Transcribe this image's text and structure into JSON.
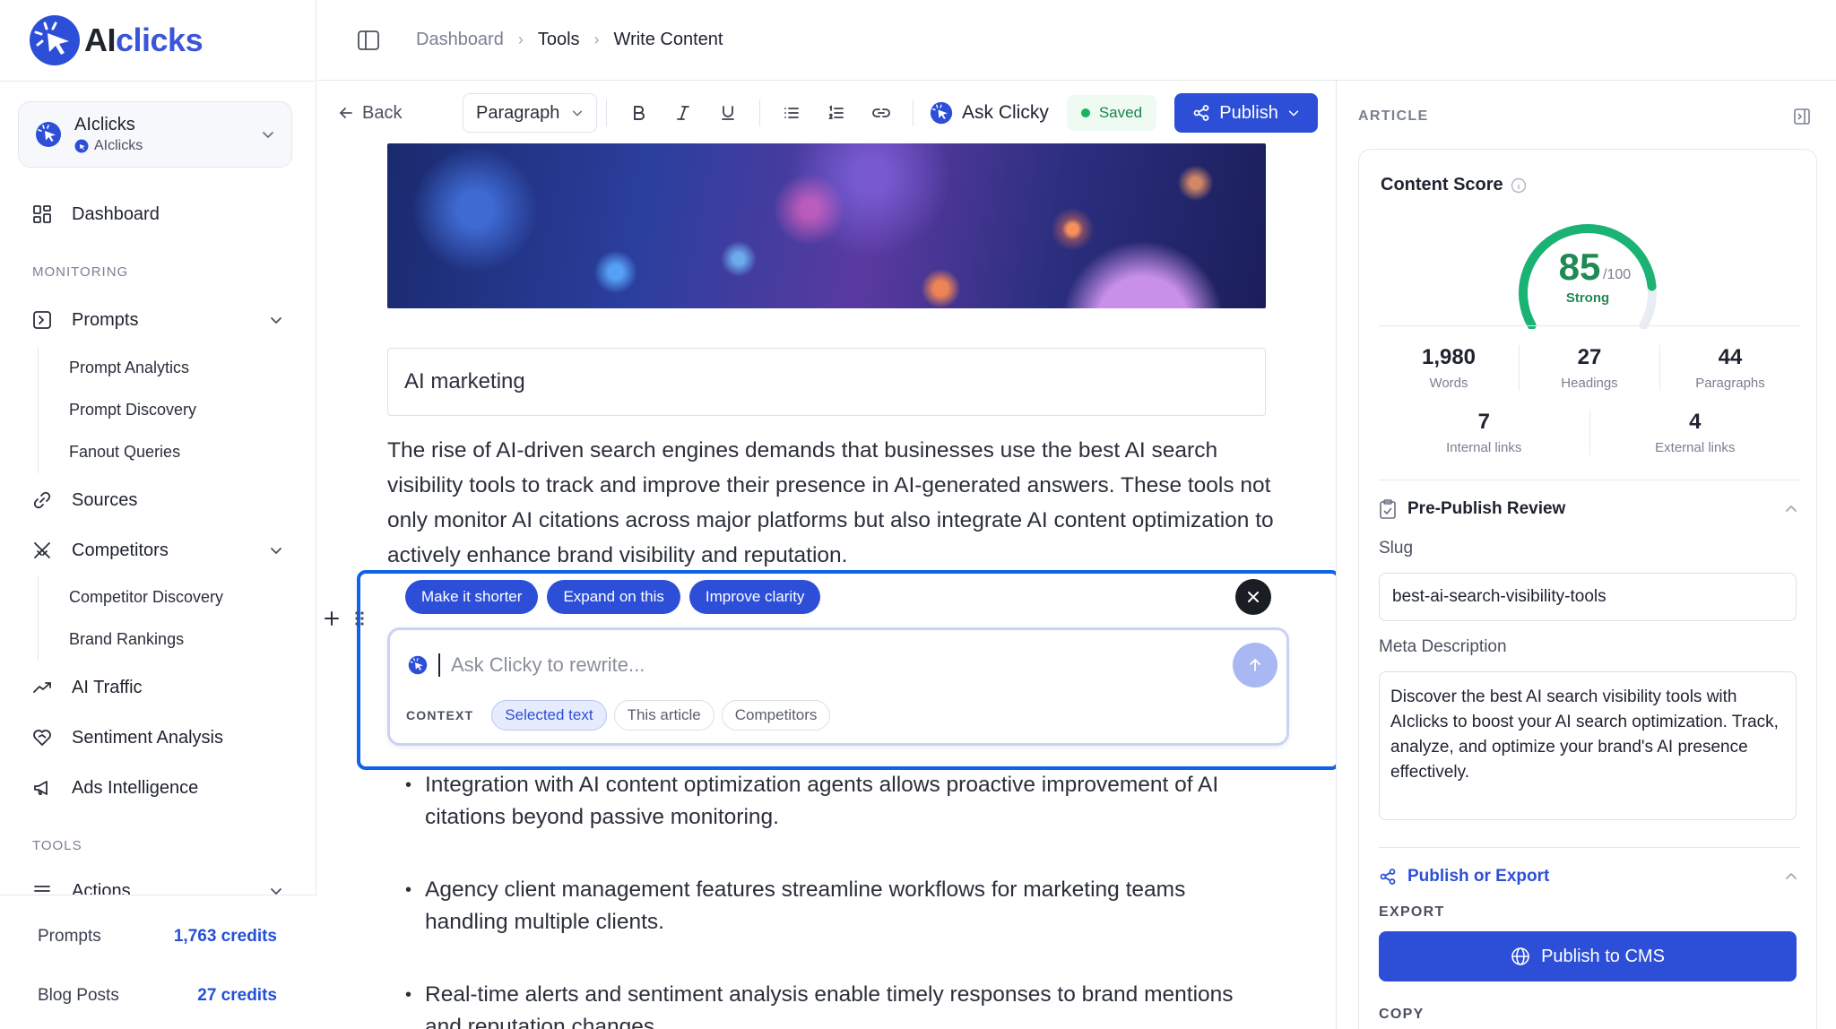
{
  "app": {
    "brand_a": "AI",
    "brand_b": "clicks",
    "accent": "#2d4fd8"
  },
  "workspace": {
    "title": "AIclicks",
    "subtitle": "AIclicks"
  },
  "sidebar": {
    "dashboard": "Dashboard",
    "monitoring_label": "MONITORING",
    "prompts": "Prompts",
    "prompts_sub": [
      "Prompt Analytics",
      "Prompt Discovery",
      "Fanout Queries"
    ],
    "sources": "Sources",
    "competitors": "Competitors",
    "competitors_sub": [
      "Competitor Discovery",
      "Brand Rankings"
    ],
    "ai_traffic": "AI Traffic",
    "sentiment": "Sentiment Analysis",
    "ads": "Ads Intelligence",
    "tools_label": "TOOLS",
    "actions": "Actions"
  },
  "credits": [
    {
      "label": "Prompts",
      "value": "1,763 credits"
    },
    {
      "label": "Blog Posts",
      "value": "27 credits"
    }
  ],
  "breadcrumb": [
    "Dashboard",
    "Tools",
    "Write Content"
  ],
  "toolbar": {
    "back": "Back",
    "block_type": "Paragraph",
    "ask_clicky": "Ask Clicky",
    "saved": "Saved",
    "publish": "Publish"
  },
  "editor": {
    "keyword": "AI marketing",
    "intro": "The rise of AI-driven search engines demands that businesses use the best AI search visibility tools to track and improve their presence in AI-generated answers. These tools not only monitor AI citations across major platforms but also integrate AI content optimization to actively enhance brand visibility and reputation.",
    "bullets": [
      "Integration with AI content optimization agents allows proactive improvement of AI citations beyond passive monitoring.",
      "Agency client management features streamline workflows for marketing teams handling multiple clients.",
      "Real-time alerts and sentiment analysis enable timely responses to brand mentions and reputation changes."
    ]
  },
  "ai_popup": {
    "chips": [
      "Make it shorter",
      "Expand on this",
      "Improve clarity"
    ],
    "placeholder": "Ask Clicky to rewrite...",
    "context_label": "CONTEXT",
    "context_options": [
      "Selected text",
      "This article",
      "Competitors"
    ],
    "context_selected": "Selected text"
  },
  "panel": {
    "header": "ARTICLE",
    "content_score": {
      "title": "Content Score",
      "score": 85,
      "max_label": "/100",
      "rating": "Strong",
      "stats_row1": [
        {
          "value": "1,980",
          "label": "Words"
        },
        {
          "value": "27",
          "label": "Headings"
        },
        {
          "value": "44",
          "label": "Paragraphs"
        }
      ],
      "stats_row2": [
        {
          "value": "7",
          "label": "Internal links"
        },
        {
          "value": "4",
          "label": "External links"
        }
      ]
    },
    "review": {
      "title": "Pre-Publish Review",
      "slug_label": "Slug",
      "slug": "best-ai-search-visibility-tools",
      "meta_label": "Meta Description",
      "meta": "Discover the best AI search visibility tools with AIclicks to boost your AI search optimization. Track, analyze, and optimize your brand's AI presence effectively."
    },
    "publish": {
      "title": "Publish or Export",
      "export_label": "EXPORT",
      "cms_button": "Publish to CMS",
      "copy_label": "COPY"
    }
  }
}
